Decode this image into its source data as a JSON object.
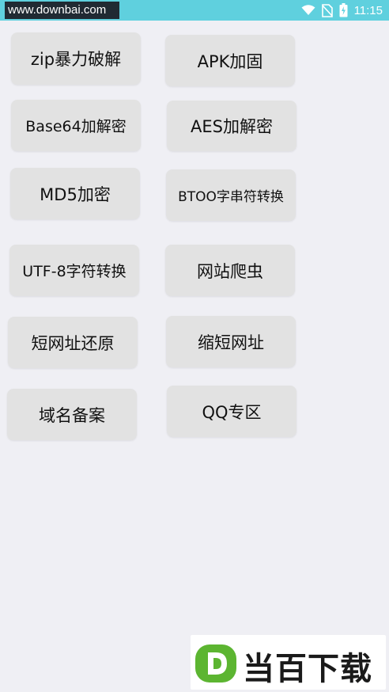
{
  "status_bar": {
    "watermark_url": "www.downbai.com",
    "time": "11:15"
  },
  "buttons": [
    {
      "label": "zip暴力破解"
    },
    {
      "label": "APK加固"
    },
    {
      "label": "Base64加解密"
    },
    {
      "label": "AES加解密"
    },
    {
      "label": "MD5加密"
    },
    {
      "label": "BTOO字串符转换"
    },
    {
      "label": "UTF-8字符转换"
    },
    {
      "label": "网站爬虫"
    },
    {
      "label": "短网址还原"
    },
    {
      "label": "缩短网址"
    },
    {
      "label": "域名备案"
    },
    {
      "label": "QQ专区"
    }
  ],
  "watermark_logo": {
    "letter": "D",
    "text": "当百下载",
    "accent_color": "#5cb531"
  }
}
